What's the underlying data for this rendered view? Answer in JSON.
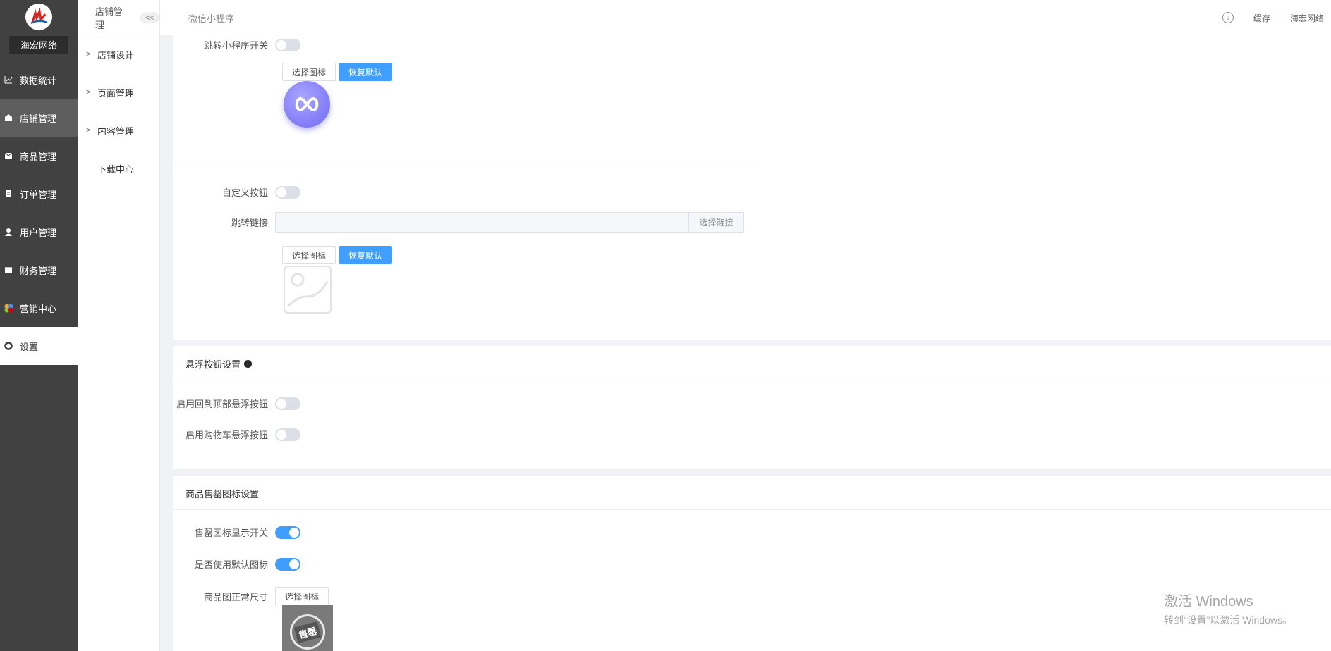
{
  "sidebar": {
    "brand": "海宏网络",
    "items": [
      {
        "label": "数据统计",
        "icon": "chart-icon"
      },
      {
        "label": "店铺管理",
        "icon": "store-icon"
      },
      {
        "label": "商品管理",
        "icon": "goods-icon"
      },
      {
        "label": "订单管理",
        "icon": "order-icon"
      },
      {
        "label": "用户管理",
        "icon": "user-icon"
      },
      {
        "label": "财务管理",
        "icon": "finance-icon"
      },
      {
        "label": "营销中心",
        "icon": "marketing-icon"
      },
      {
        "label": "设置",
        "icon": "settings-icon"
      }
    ]
  },
  "subbar": {
    "title": "店铺管理",
    "collapse": "<<",
    "items": [
      "店铺设计",
      "页面管理",
      "内容管理",
      "下载中心"
    ]
  },
  "topbar": {
    "tab": "微信小程序",
    "cache": "缓存",
    "user": "海宏网络"
  },
  "section1": {
    "mini_switch_label": "跳转小程序开关",
    "select_icon": "选择图标",
    "restore_default": "恢复默认",
    "custom_button_label": "自定义按钮",
    "jump_link_label": "跳转链接",
    "jump_link_value": "",
    "select_link": "选择链接"
  },
  "float": {
    "title": "悬浮按钮设置",
    "back_to_top_label": "启用回到顶部悬浮按钮",
    "cart_label": "启用购物车悬浮按钮"
  },
  "soldout": {
    "title": "商品售罄图标设置",
    "display_switch_label": "售罄图标显示开关",
    "default_icon_label": "是否使用默认图标",
    "normal_size_label": "商品图正常尺寸",
    "select_icon": "选择图标",
    "stamp_text": "售罄"
  },
  "watermark": {
    "line1": "激活 Windows",
    "line2": "转到“设置”以激活 Windows。"
  },
  "colors": {
    "primary": "#409eff",
    "sidebar": "#414141"
  }
}
